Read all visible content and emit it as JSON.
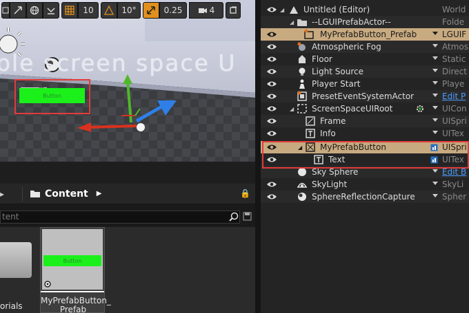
{
  "viewport": {
    "toolbar": {
      "grid_snap_value": "10",
      "rotation_snap_value": "10°",
      "scale_snap_value": "0.25",
      "camera_speed_value": "4"
    },
    "world_text": "ple screen space U",
    "button_preview_label": "Button"
  },
  "content_browser": {
    "breadcrumb": "Content",
    "search_placeholder": "tent",
    "folder_label": "orials",
    "asset": {
      "label_line1": "MyPrefabButton_",
      "label_line2": "Prefab",
      "thumb_button_label": "Button"
    }
  },
  "outliner": {
    "rows": [
      {
        "name": "Untitled (Editor)",
        "type": "World"
      },
      {
        "name": "--LGUIPrefabActor--",
        "type": "Folde"
      },
      {
        "name": "MyPrefabButton_Prefab",
        "type": "LGUIF"
      },
      {
        "name": "Atmospheric Fog",
        "type": "Atmos"
      },
      {
        "name": "Floor",
        "type": "Static"
      },
      {
        "name": "Light Source",
        "type": "Direct"
      },
      {
        "name": "Player Start",
        "type": "Playe"
      },
      {
        "name": "PresetEventSystemActor",
        "type": "Edit P"
      },
      {
        "name": "ScreenSpaceUIRoot",
        "type": "UICon"
      },
      {
        "name": "Frame",
        "type": "UISpri"
      },
      {
        "name": "Info",
        "type": "UITex"
      },
      {
        "name": "MyPrefabButton",
        "type": "UISpri"
      },
      {
        "name": "Text",
        "type": "UITex"
      },
      {
        "name": "Sky Sphere",
        "type": "Edit B"
      },
      {
        "name": "SkyLight",
        "type": "SkyLi"
      },
      {
        "name": "SphereReflectionCapture",
        "type": "Spher"
      }
    ]
  },
  "colors": {
    "selection": "#c8aa80",
    "highlight_red": "#e23b3b",
    "link_blue": "#4a9eff",
    "button_green": "#1bf01b",
    "toolbar_orange": "#e0901c"
  }
}
